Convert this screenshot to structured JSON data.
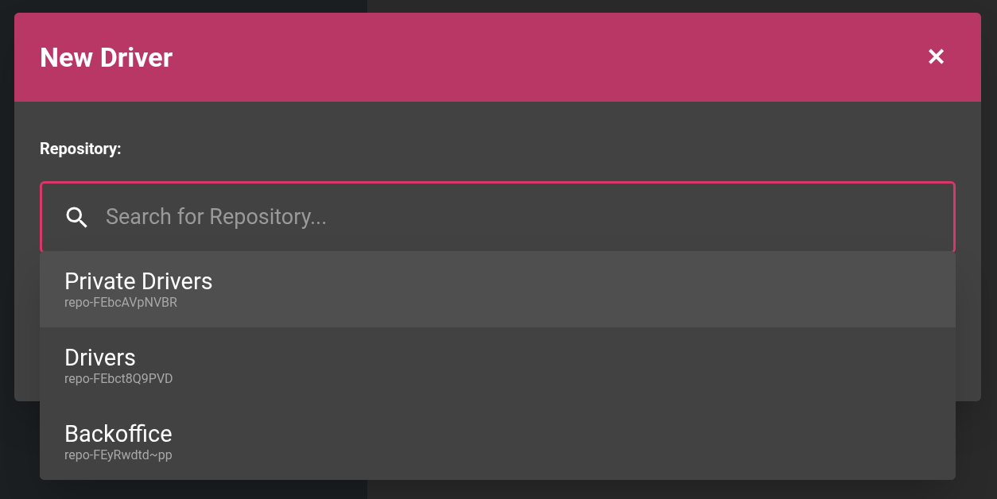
{
  "dialog": {
    "title": "New Driver",
    "close": "✕"
  },
  "repository": {
    "label": "Repository:",
    "placeholder": "Search for Repository...",
    "focused": true
  },
  "options": [
    {
      "name": "Private Drivers",
      "id": "repo-FEbcAVpNVBR",
      "selected": true
    },
    {
      "name": "Drivers",
      "id": "repo-FEbct8Q9PVD",
      "selected": false
    },
    {
      "name": "Backoffice",
      "id": "repo-FEyRwdtd~pp",
      "selected": false
    }
  ]
}
